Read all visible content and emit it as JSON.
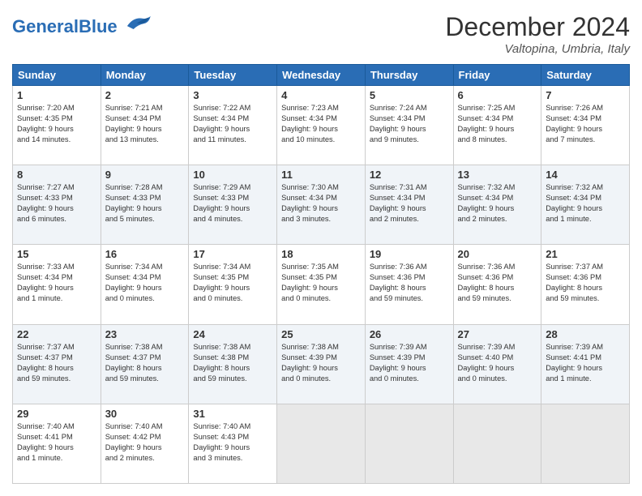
{
  "header": {
    "logo_general": "General",
    "logo_blue": "Blue",
    "month_title": "December 2024",
    "location": "Valtopina, Umbria, Italy"
  },
  "days_of_week": [
    "Sunday",
    "Monday",
    "Tuesday",
    "Wednesday",
    "Thursday",
    "Friday",
    "Saturday"
  ],
  "weeks": [
    [
      {
        "day": "1",
        "info": "Sunrise: 7:20 AM\nSunset: 4:35 PM\nDaylight: 9 hours\nand 14 minutes."
      },
      {
        "day": "2",
        "info": "Sunrise: 7:21 AM\nSunset: 4:34 PM\nDaylight: 9 hours\nand 13 minutes."
      },
      {
        "day": "3",
        "info": "Sunrise: 7:22 AM\nSunset: 4:34 PM\nDaylight: 9 hours\nand 11 minutes."
      },
      {
        "day": "4",
        "info": "Sunrise: 7:23 AM\nSunset: 4:34 PM\nDaylight: 9 hours\nand 10 minutes."
      },
      {
        "day": "5",
        "info": "Sunrise: 7:24 AM\nSunset: 4:34 PM\nDaylight: 9 hours\nand 9 minutes."
      },
      {
        "day": "6",
        "info": "Sunrise: 7:25 AM\nSunset: 4:34 PM\nDaylight: 9 hours\nand 8 minutes."
      },
      {
        "day": "7",
        "info": "Sunrise: 7:26 AM\nSunset: 4:34 PM\nDaylight: 9 hours\nand 7 minutes."
      }
    ],
    [
      {
        "day": "8",
        "info": "Sunrise: 7:27 AM\nSunset: 4:33 PM\nDaylight: 9 hours\nand 6 minutes."
      },
      {
        "day": "9",
        "info": "Sunrise: 7:28 AM\nSunset: 4:33 PM\nDaylight: 9 hours\nand 5 minutes."
      },
      {
        "day": "10",
        "info": "Sunrise: 7:29 AM\nSunset: 4:33 PM\nDaylight: 9 hours\nand 4 minutes."
      },
      {
        "day": "11",
        "info": "Sunrise: 7:30 AM\nSunset: 4:34 PM\nDaylight: 9 hours\nand 3 minutes."
      },
      {
        "day": "12",
        "info": "Sunrise: 7:31 AM\nSunset: 4:34 PM\nDaylight: 9 hours\nand 2 minutes."
      },
      {
        "day": "13",
        "info": "Sunrise: 7:32 AM\nSunset: 4:34 PM\nDaylight: 9 hours\nand 2 minutes."
      },
      {
        "day": "14",
        "info": "Sunrise: 7:32 AM\nSunset: 4:34 PM\nDaylight: 9 hours\nand 1 minute."
      }
    ],
    [
      {
        "day": "15",
        "info": "Sunrise: 7:33 AM\nSunset: 4:34 PM\nDaylight: 9 hours\nand 1 minute."
      },
      {
        "day": "16",
        "info": "Sunrise: 7:34 AM\nSunset: 4:34 PM\nDaylight: 9 hours\nand 0 minutes."
      },
      {
        "day": "17",
        "info": "Sunrise: 7:34 AM\nSunset: 4:35 PM\nDaylight: 9 hours\nand 0 minutes."
      },
      {
        "day": "18",
        "info": "Sunrise: 7:35 AM\nSunset: 4:35 PM\nDaylight: 9 hours\nand 0 minutes."
      },
      {
        "day": "19",
        "info": "Sunrise: 7:36 AM\nSunset: 4:36 PM\nDaylight: 8 hours\nand 59 minutes."
      },
      {
        "day": "20",
        "info": "Sunrise: 7:36 AM\nSunset: 4:36 PM\nDaylight: 8 hours\nand 59 minutes."
      },
      {
        "day": "21",
        "info": "Sunrise: 7:37 AM\nSunset: 4:36 PM\nDaylight: 8 hours\nand 59 minutes."
      }
    ],
    [
      {
        "day": "22",
        "info": "Sunrise: 7:37 AM\nSunset: 4:37 PM\nDaylight: 8 hours\nand 59 minutes."
      },
      {
        "day": "23",
        "info": "Sunrise: 7:38 AM\nSunset: 4:37 PM\nDaylight: 8 hours\nand 59 minutes."
      },
      {
        "day": "24",
        "info": "Sunrise: 7:38 AM\nSunset: 4:38 PM\nDaylight: 8 hours\nand 59 minutes."
      },
      {
        "day": "25",
        "info": "Sunrise: 7:38 AM\nSunset: 4:39 PM\nDaylight: 9 hours\nand 0 minutes."
      },
      {
        "day": "26",
        "info": "Sunrise: 7:39 AM\nSunset: 4:39 PM\nDaylight: 9 hours\nand 0 minutes."
      },
      {
        "day": "27",
        "info": "Sunrise: 7:39 AM\nSunset: 4:40 PM\nDaylight: 9 hours\nand 0 minutes."
      },
      {
        "day": "28",
        "info": "Sunrise: 7:39 AM\nSunset: 4:41 PM\nDaylight: 9 hours\nand 1 minute."
      }
    ],
    [
      {
        "day": "29",
        "info": "Sunrise: 7:40 AM\nSunset: 4:41 PM\nDaylight: 9 hours\nand 1 minute."
      },
      {
        "day": "30",
        "info": "Sunrise: 7:40 AM\nSunset: 4:42 PM\nDaylight: 9 hours\nand 2 minutes."
      },
      {
        "day": "31",
        "info": "Sunrise: 7:40 AM\nSunset: 4:43 PM\nDaylight: 9 hours\nand 3 minutes."
      },
      {
        "day": "",
        "info": ""
      },
      {
        "day": "",
        "info": ""
      },
      {
        "day": "",
        "info": ""
      },
      {
        "day": "",
        "info": ""
      }
    ]
  ]
}
